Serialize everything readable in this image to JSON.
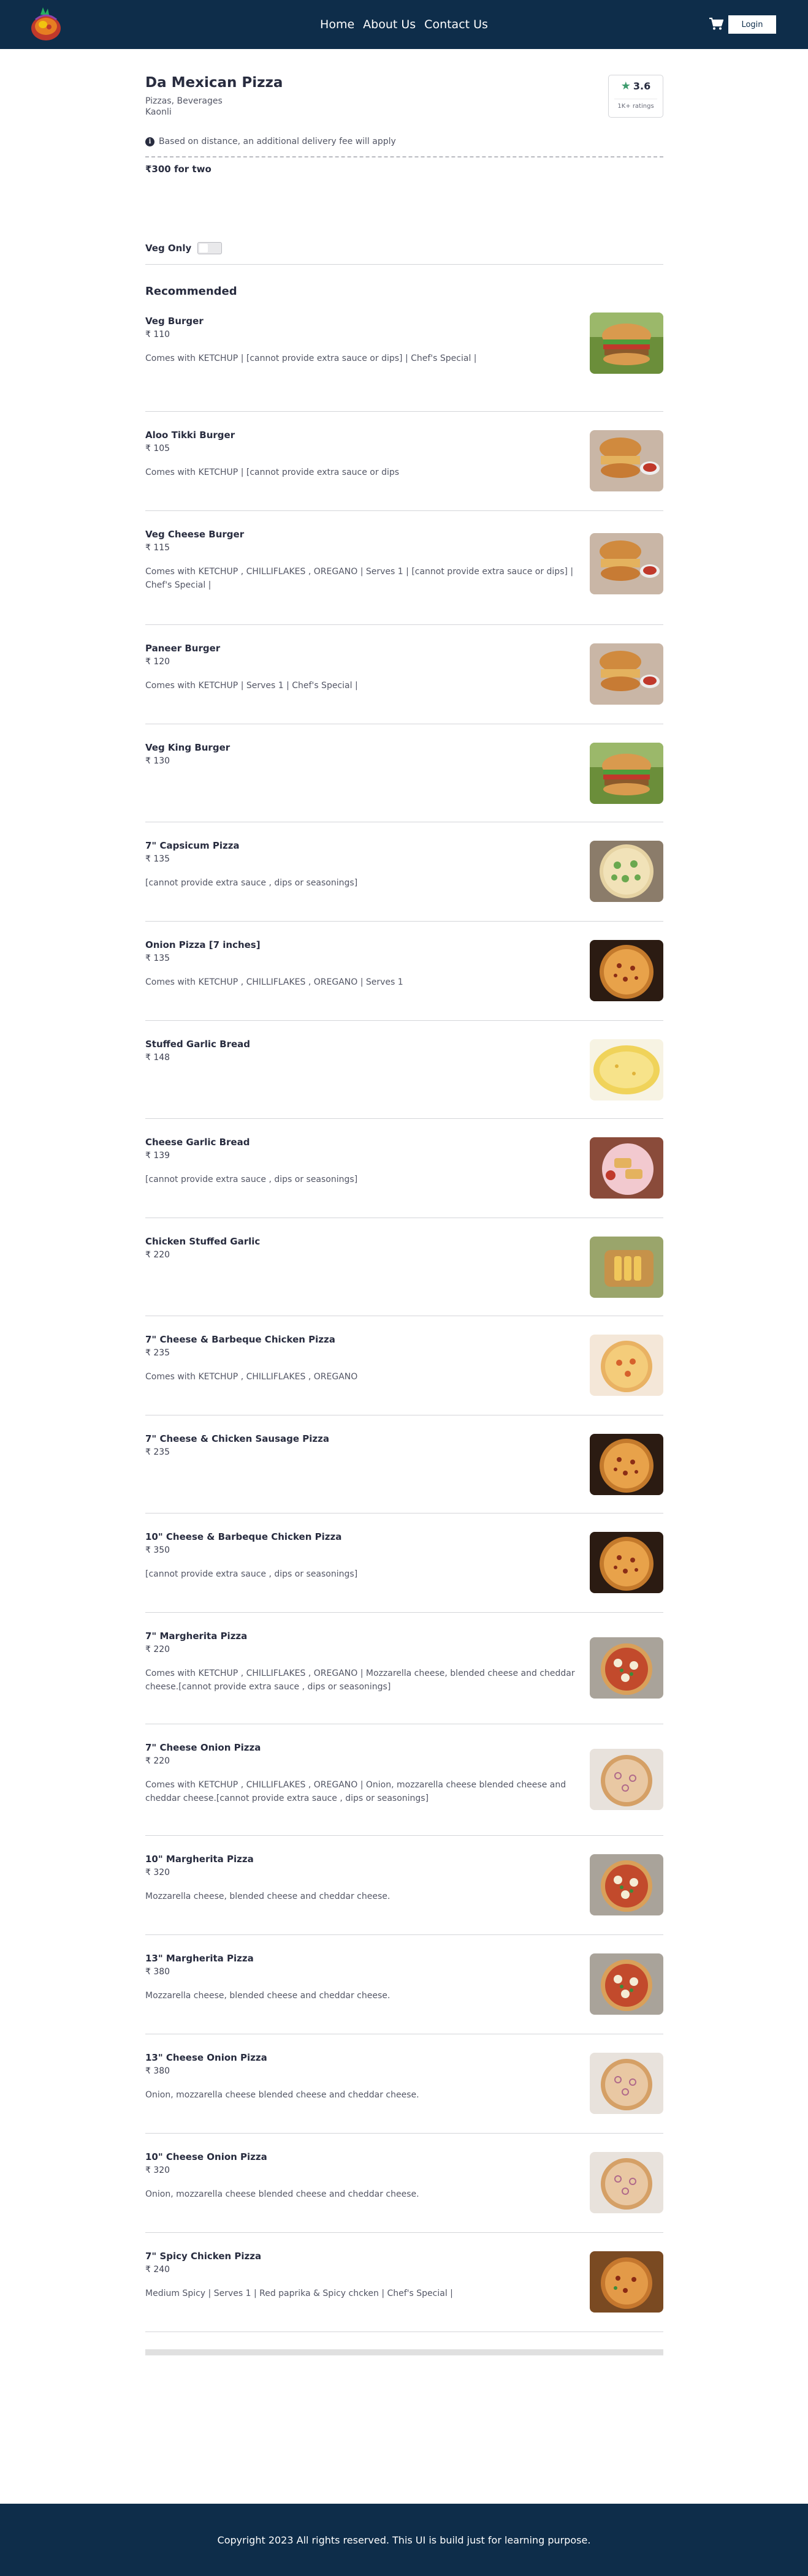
{
  "header": {
    "nav": [
      "Home",
      "About Us",
      "Contact Us"
    ],
    "login_label": "Login"
  },
  "restaurant": {
    "name": "Da Mexican Pizza",
    "cuisines": "Pizzas, Beverages",
    "area": "Kaonli",
    "rating": "3.6",
    "rating_count": "1K+ ratings",
    "fee_note": "Based on distance, an additional delivery fee will apply",
    "cost_for_two": "₹300 for two"
  },
  "filters": {
    "veg_only_label": "Veg Only",
    "veg_only_on": false
  },
  "section_title": "Recommended",
  "items": [
    {
      "name": "Veg Burger",
      "price": "₹ 110",
      "desc": "Comes with KETCHUP | [cannot provide extra sauce or dips] | Chef's Special |",
      "img": "burger"
    },
    {
      "name": "Aloo Tikki Burger",
      "price": "₹ 105",
      "desc": "Comes with KETCHUP | [cannot provide extra sauce or dips",
      "img": "burger-dip"
    },
    {
      "name": "Veg Cheese Burger",
      "price": "₹ 115",
      "desc": "Comes with KETCHUP , CHILLIFLAKES , OREGANO | Serves 1 | [cannot provide extra sauce or dips] | Chef's Special |",
      "img": "burger-dip"
    },
    {
      "name": "Paneer Burger",
      "price": "₹ 120",
      "desc": "Comes with KETCHUP | Serves 1 | Chef's Special |",
      "img": "burger-dip"
    },
    {
      "name": "Veg King Burger",
      "price": "₹ 130",
      "desc": "",
      "img": "burger"
    },
    {
      "name": "7\" Capsicum Pizza",
      "price": "₹ 135",
      "desc": "[cannot provide extra sauce , dips or seasonings]",
      "img": "pizza-green"
    },
    {
      "name": "Onion Pizza [7 inches]",
      "price": "₹ 135",
      "desc": "Comes with KETCHUP , CHILLIFLAKES , OREGANO | Serves 1",
      "img": "pizza-dark"
    },
    {
      "name": "Stuffed Garlic Bread",
      "price": "₹ 148",
      "desc": "",
      "img": "garlic"
    },
    {
      "name": "Cheese Garlic Bread",
      "price": "₹ 139",
      "desc": "[cannot provide extra sauce , dips or seasonings]",
      "img": "bread-plate"
    },
    {
      "name": "Chicken Stuffed Garlic",
      "price": "₹ 220",
      "desc": "",
      "img": "bread-board"
    },
    {
      "name": "7\" Cheese & Barbeque Chicken Pizza",
      "price": "₹ 235",
      "desc": "Comes with KETCHUP , CHILLIFLAKES , OREGANO",
      "img": "pizza-light"
    },
    {
      "name": "7\" Cheese & Chicken Sausage Pizza",
      "price": "₹ 235",
      "desc": "",
      "img": "pizza-dark"
    },
    {
      "name": "10\" Cheese & Barbeque Chicken Pizza",
      "price": "₹ 350",
      "desc": "[cannot provide extra sauce , dips or seasonings]",
      "img": "pizza-dark"
    },
    {
      "name": "7\" Margherita Pizza",
      "price": "₹ 220",
      "desc": "Comes with KETCHUP , CHILLIFLAKES , OREGANO | Mozzarella cheese, blended cheese and cheddar cheese.[cannot provide extra sauce , dips or seasonings]",
      "img": "pizza-marg"
    },
    {
      "name": "7\" Cheese Onion Pizza",
      "price": "₹ 220",
      "desc": "Comes with KETCHUP , CHILLIFLAKES , OREGANO | Onion, mozzarella cheese blended cheese and cheddar cheese.[cannot provide extra sauce , dips or seasonings]",
      "img": "pizza-onion"
    },
    {
      "name": "10\" Margherita Pizza",
      "price": "₹ 320",
      "desc": "Mozzarella cheese, blended cheese and cheddar cheese.",
      "img": "pizza-marg"
    },
    {
      "name": "13\" Margherita Pizza",
      "price": "₹ 380",
      "desc": "Mozzarella cheese, blended cheese and cheddar cheese.",
      "img": "pizza-marg"
    },
    {
      "name": "13\" Cheese Onion Pizza",
      "price": "₹ 380",
      "desc": "Onion, mozzarella cheese blended cheese and cheddar cheese.",
      "img": "pizza-onion"
    },
    {
      "name": "10\" Cheese Onion Pizza",
      "price": "₹ 320",
      "desc": "Onion, mozzarella cheese blended cheese and cheddar cheese.",
      "img": "pizza-onion"
    },
    {
      "name": "7\" Spicy Chicken Pizza",
      "price": "₹ 240",
      "desc": "Medium Spicy | Serves 1 | Red paprika & Spicy chcken | Chef's Special |",
      "img": "pizza-spicy"
    }
  ],
  "footer": {
    "text": "Copyright 2023 All rights reserved. This UI is build just for learning purpose."
  },
  "colors": {
    "header_bg": "#0e2d4a",
    "rating_green": "#3d9b6d"
  }
}
